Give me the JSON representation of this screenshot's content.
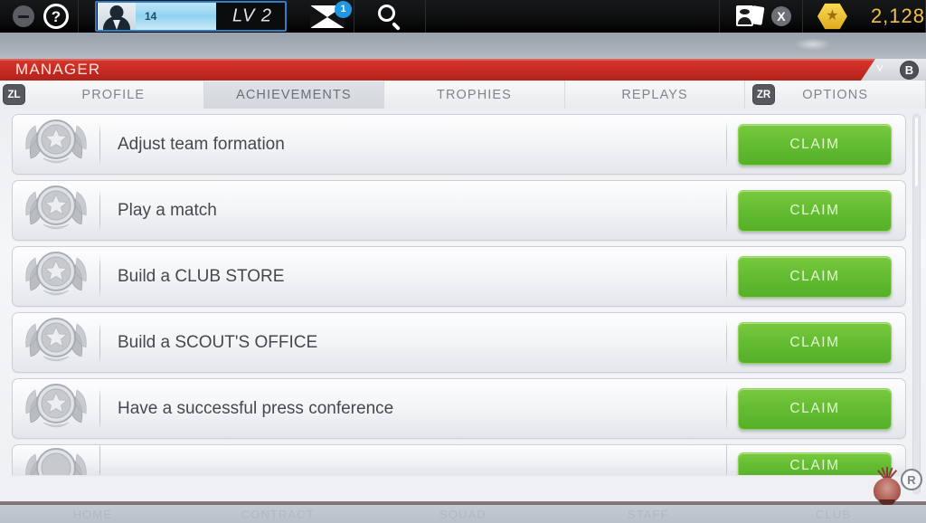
{
  "header": {
    "minus_icon": "minus-icon",
    "help_icon": "help-icon",
    "avatar_icon": "avatar-icon",
    "xp_value": "14",
    "level_label": "LV 2",
    "xp_percent": 54,
    "mail_icon": "mail-icon",
    "mail_badge": "1",
    "search_icon": "search-icon",
    "cards_icon": "cards-icon",
    "cards_multiplier": "X",
    "coin_icon": "star-coin-icon",
    "currency_amount": "2,128"
  },
  "banner": {
    "title": "MANAGER",
    "chevron_icon": "chevron-down-icon",
    "back_button": "B"
  },
  "tabs": {
    "left_shoulder": "ZL",
    "right_shoulder": "ZR",
    "items": [
      {
        "label": "PROFILE",
        "active": false
      },
      {
        "label": "ACHIEVEMENTS",
        "active": true
      },
      {
        "label": "TROPHIES",
        "active": false
      },
      {
        "label": "REPLAYS",
        "active": false
      },
      {
        "label": "OPTIONS",
        "active": false
      }
    ]
  },
  "achievements": {
    "claim_label": "CLAIM",
    "medal_icon": "laurel-medal-icon",
    "rows": [
      {
        "title": "Adjust team formation"
      },
      {
        "title": "Play a match"
      },
      {
        "title": "Build a CLUB STORE"
      },
      {
        "title": "Build a SCOUT'S OFFICE"
      },
      {
        "title": "Have a successful press conference"
      },
      {
        "title": ""
      }
    ]
  },
  "scrollbar": {
    "thumb_position_percent": 0
  },
  "bottom_nav": {
    "items": [
      {
        "label": "HOME"
      },
      {
        "label": "CONTRACT"
      },
      {
        "label": "SQUAD"
      },
      {
        "label": "STAFF"
      },
      {
        "label": "CLUB"
      }
    ],
    "crest_icon": "club-crest-icon",
    "r_button": "R"
  },
  "colors": {
    "accent_red": "#c62a22",
    "claim_green": "#65bd33",
    "xp_blue": "#8fd2ef",
    "coin_gold": "#e0a81e",
    "badge_blue": "#2196e3"
  }
}
